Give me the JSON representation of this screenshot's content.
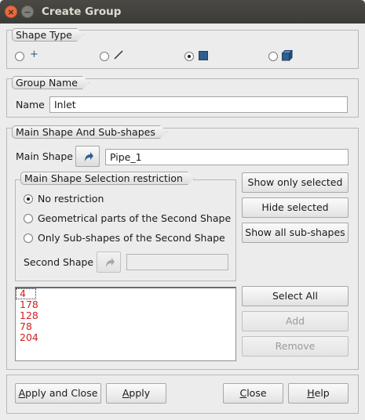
{
  "window": {
    "title": "Create Group",
    "close_glyph": "×",
    "minimize_glyph": "−"
  },
  "shape_type": {
    "label": "Shape Type",
    "options": [
      {
        "icon": "point-icon",
        "glyph": "+",
        "selected": false
      },
      {
        "icon": "edge-icon",
        "selected": false
      },
      {
        "icon": "face-icon",
        "selected": true
      },
      {
        "icon": "solid-icon",
        "selected": false
      }
    ]
  },
  "group_name": {
    "label": "Group Name",
    "name_label": "Name",
    "value": "Inlet"
  },
  "main_shape": {
    "section_label": "Main Shape And Sub-shapes",
    "label": "Main Shape",
    "value": "Pipe_1",
    "restriction": {
      "label": "Main Shape Selection restriction",
      "options": [
        {
          "label": "No restriction",
          "selected": true
        },
        {
          "label": "Geometrical parts of the Second Shape",
          "selected": false
        },
        {
          "label": "Only Sub-shapes of the Second Shape",
          "selected": false
        }
      ],
      "second_shape_label": "Second Shape",
      "second_shape_value": ""
    },
    "buttons": {
      "show_only_selected": "Show only selected",
      "hide_selected": "Hide selected",
      "show_all": "Show all sub-shapes",
      "select_all": "Select All",
      "add": "Add",
      "remove": "Remove"
    },
    "ids": [
      "4",
      "178",
      "128",
      "78",
      "204"
    ]
  },
  "footer": {
    "apply_close": {
      "pre": "",
      "key": "A",
      "post": "pply and Close"
    },
    "apply": {
      "pre": "",
      "key": "A",
      "post": "pply"
    },
    "close": {
      "pre": "",
      "key": "C",
      "post": "lose"
    },
    "help": {
      "pre": "",
      "key": "H",
      "post": "elp"
    }
  },
  "colors": {
    "id_text": "#d21f1f",
    "icon_blue": "#2e5f8f"
  }
}
